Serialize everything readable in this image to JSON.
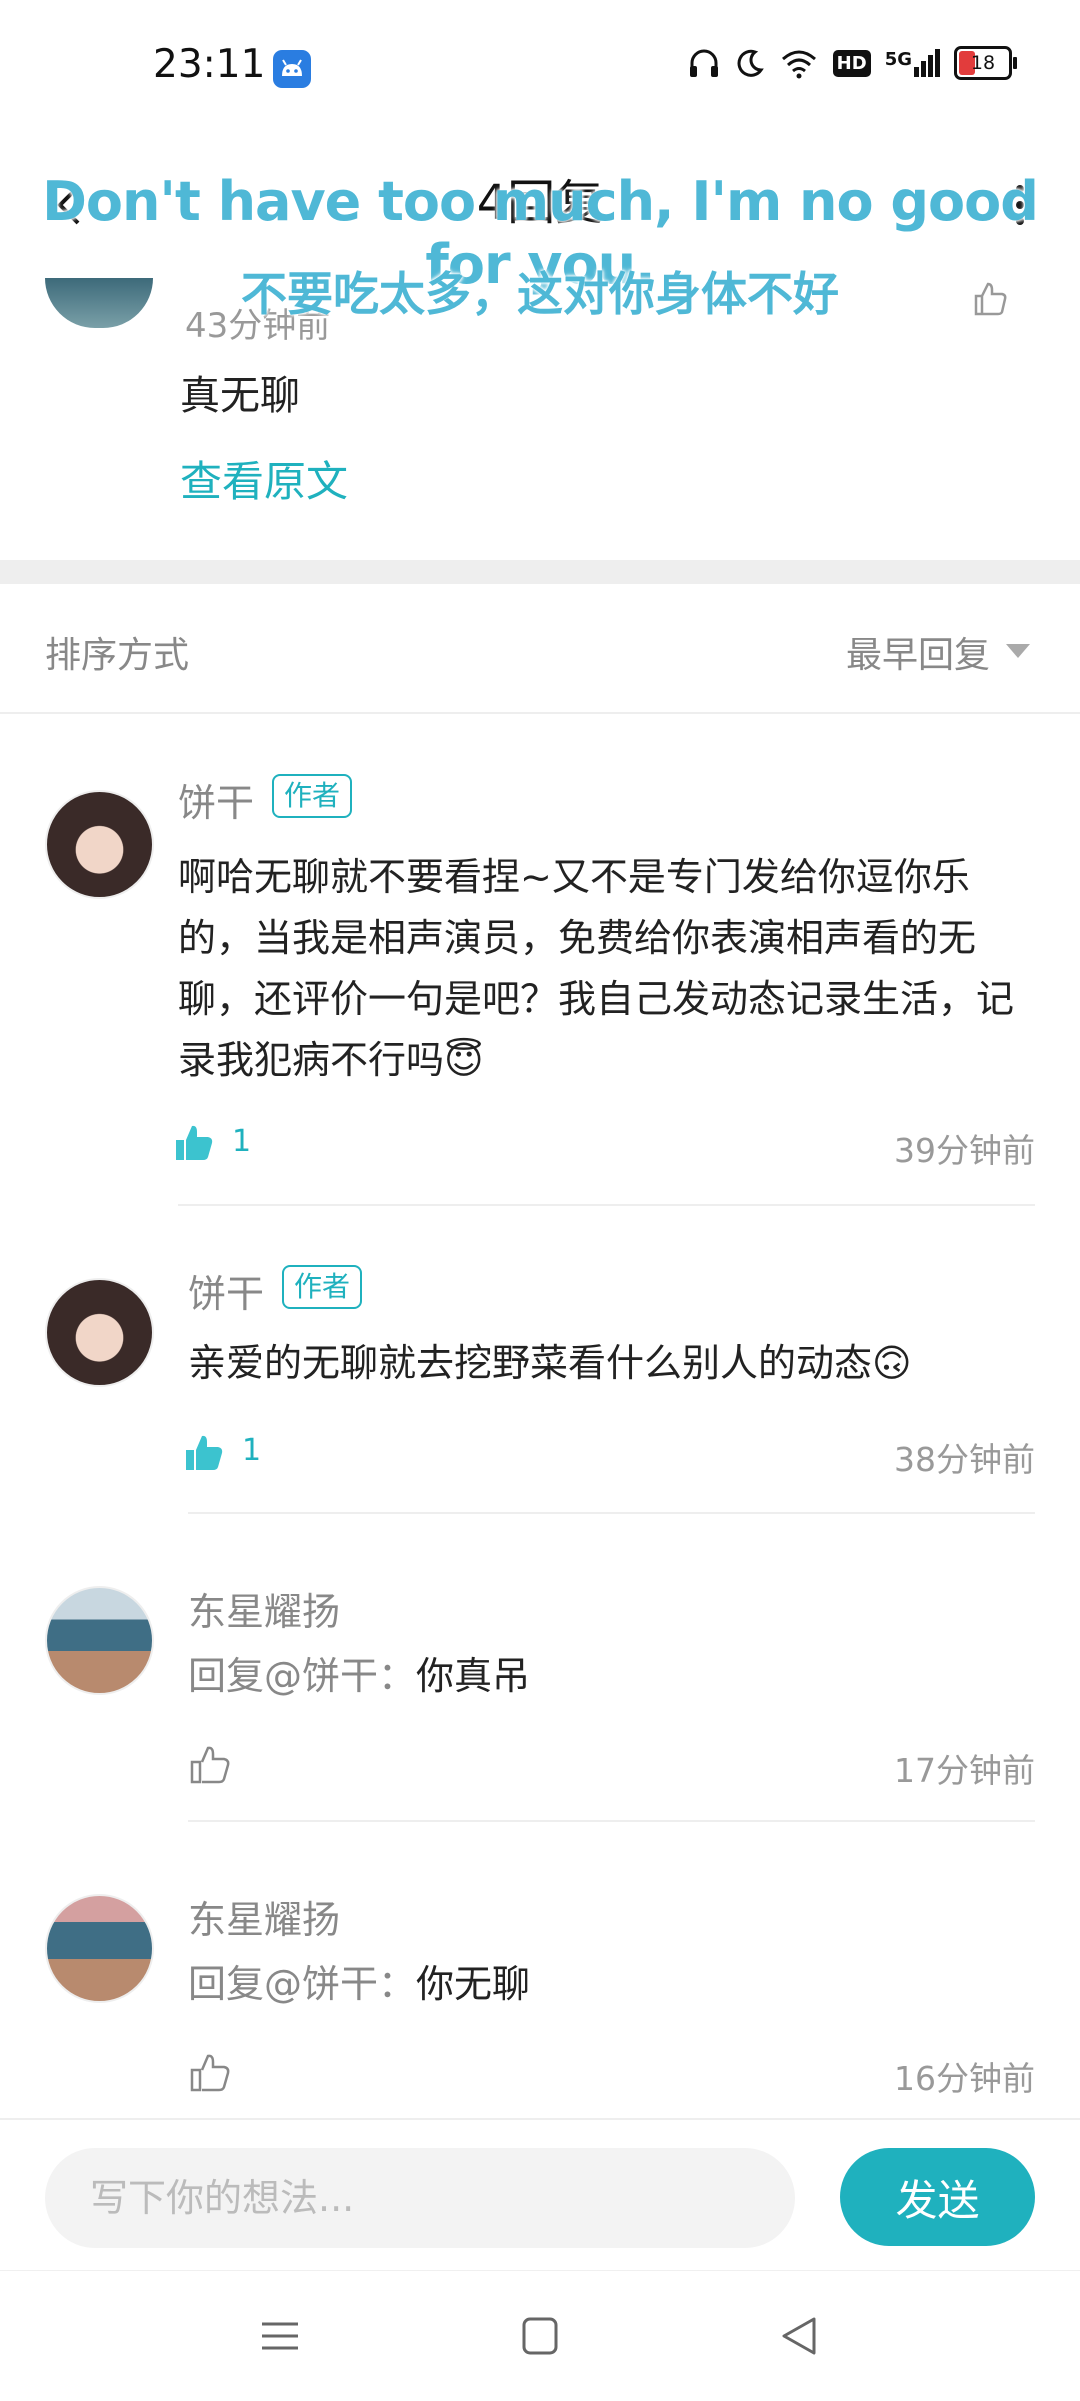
{
  "status_bar": {
    "time": "23:11",
    "battery": "18",
    "network": "5G",
    "hd": "HD"
  },
  "header": {
    "title": "4回复"
  },
  "subtitles": {
    "english": "Don't have too much, I'm no good for you.",
    "chinese": "不要吃太多，这对你身体不好"
  },
  "original_post": {
    "time": "43分钟前",
    "text": "真无聊",
    "view_original": "查看原文"
  },
  "sort": {
    "label": "排序方式",
    "value": "最早回复"
  },
  "replies": [
    {
      "author": "饼干",
      "badge": "作者",
      "text": "啊哈无聊就不要看捏~又不是专门发给你逗你乐的，当我是相声演员，免费给你表演相声看的无聊，还评价一句是吧？我自己发动态记录生活，记录我犯病不行吗😇",
      "likes": "1",
      "time": "39分钟前",
      "liked": true
    },
    {
      "author": "饼干",
      "badge": "作者",
      "text": "亲爱的无聊就去挖野菜看什么别人的动态🙃",
      "likes": "1",
      "time": "38分钟前",
      "liked": true
    },
    {
      "author": "东星耀扬",
      "mention": "回复@饼干：",
      "text": "你真吊",
      "time": "17分钟前",
      "liked": false
    },
    {
      "author": "东星耀扬",
      "mention": "回复@饼干：",
      "text": "你无聊",
      "time": "16分钟前",
      "liked": false
    }
  ],
  "reply_box": {
    "placeholder": "写下你的想法...",
    "send_label": "发送"
  },
  "colors": {
    "accent": "#1fb1be",
    "subtitle": "#4fb8d6"
  },
  "icons": {
    "back": "chevron-left-icon",
    "more": "more-vertical-icon",
    "like": "thumbs-up-icon",
    "nav": [
      "menu-icon",
      "home-square-icon",
      "back-triangle-icon"
    ]
  }
}
